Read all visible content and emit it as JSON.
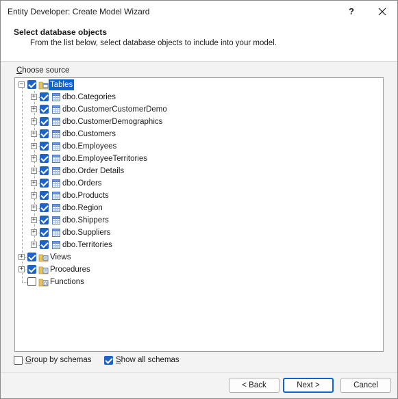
{
  "window": {
    "title": "Entity Developer: Create Model Wizard",
    "help_label": "?"
  },
  "header": {
    "title": "Select database objects",
    "subtitle": "From the list below, select database objects to include into your model."
  },
  "choose_source": {
    "label_accel": "C",
    "label_rest": "hoose source"
  },
  "tree": {
    "root": {
      "label": "Tables",
      "checked": true,
      "expanded": true,
      "selected": true,
      "icon": "folder-table-icon"
    },
    "tables": [
      {
        "label": "dbo.Categories",
        "checked": true
      },
      {
        "label": "dbo.CustomerCustomerDemo",
        "checked": true
      },
      {
        "label": "dbo.CustomerDemographics",
        "checked": true
      },
      {
        "label": "dbo.Customers",
        "checked": true
      },
      {
        "label": "dbo.Employees",
        "checked": true
      },
      {
        "label": "dbo.EmployeeTerritories",
        "checked": true
      },
      {
        "label": "dbo.Order Details",
        "checked": true
      },
      {
        "label": "dbo.Orders",
        "checked": true
      },
      {
        "label": "dbo.Products",
        "checked": true
      },
      {
        "label": "dbo.Region",
        "checked": true
      },
      {
        "label": "dbo.Shippers",
        "checked": true
      },
      {
        "label": "dbo.Suppliers",
        "checked": true
      },
      {
        "label": "dbo.Territories",
        "checked": true
      }
    ],
    "others": [
      {
        "label": "Views",
        "checked": true,
        "expander": true,
        "icon": "folder-view-icon"
      },
      {
        "label": "Procedures",
        "checked": true,
        "expander": true,
        "icon": "folder-procedure-icon"
      },
      {
        "label": "Functions",
        "checked": false,
        "expander": false,
        "icon": "folder-function-icon"
      }
    ]
  },
  "options": {
    "group_by_schemas": {
      "accel": "G",
      "rest": "roup by schemas",
      "checked": false
    },
    "show_all_schemas": {
      "accel": "S",
      "rest": "how all schemas",
      "checked": true
    }
  },
  "buttons": {
    "back": "< Back",
    "next": "Next >",
    "cancel": "Cancel"
  },
  "colors": {
    "accent": "#0a64d6",
    "checkbox": "#1f63c6",
    "folder": "#e8c25a"
  }
}
